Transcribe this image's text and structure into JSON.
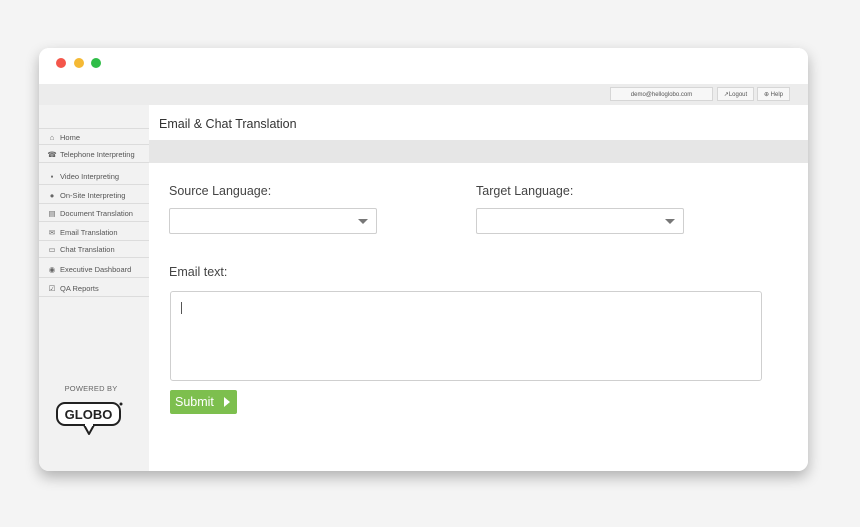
{
  "window": {
    "controls": [
      "close-dot",
      "minimize-dot",
      "maximize-dot"
    ],
    "colors": {
      "close": "#f4564b",
      "minimize": "#f5b934",
      "maximize": "#2fbd47"
    }
  },
  "topbar": {
    "email": "demo@helloglobo.com",
    "logout_label": "Logout",
    "help_label": "Help"
  },
  "sidebar": {
    "items": [
      {
        "label": "Home",
        "icon": "home-icon",
        "glyph": "⌂"
      },
      {
        "label": "Telephone Interpreting",
        "icon": "phone-icon",
        "glyph": "☎"
      },
      {
        "label": "Video Interpreting",
        "icon": "video-icon",
        "glyph": "▪"
      },
      {
        "label": "On-Site Interpreting",
        "icon": "location-pin-icon",
        "glyph": "●"
      },
      {
        "label": "Document Translation",
        "icon": "document-icon",
        "glyph": "▤"
      },
      {
        "label": "Email Translation",
        "icon": "email-icon",
        "glyph": "✉"
      },
      {
        "label": "Chat Translation",
        "icon": "chat-icon",
        "glyph": "▭"
      },
      {
        "label": "Executive Dashboard",
        "icon": "dashboard-icon",
        "glyph": "◉"
      },
      {
        "label": "QA Reports",
        "icon": "report-icon",
        "glyph": "☑"
      }
    ],
    "powered_by": "POWERED BY",
    "logo_text": "GLOBO"
  },
  "main": {
    "title": "Email & Chat Translation",
    "source_label": "Source Language:",
    "source_value": "",
    "target_label": "Target Language:",
    "target_value": "",
    "email_text_label": "Email text:",
    "email_text_value": "",
    "submit_label": "Submit"
  },
  "colors": {
    "accent_green": "#7dbf4e",
    "sidebar_bg": "#f2f2f2",
    "band_gray": "#e6e6e6"
  }
}
